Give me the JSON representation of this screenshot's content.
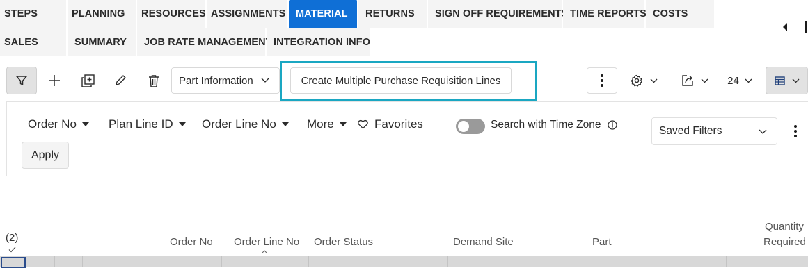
{
  "tabs_row1": [
    {
      "label": "STEPS"
    },
    {
      "label": "PLANNING"
    },
    {
      "label": "RESOURCES"
    },
    {
      "label": "ASSIGNMENTS"
    },
    {
      "label": "MATERIAL",
      "active": true
    },
    {
      "label": "RETURNS"
    },
    {
      "label": "SIGN OFF REQUIREMENTS"
    },
    {
      "label": "TIME REPORTS"
    },
    {
      "label": "COSTS"
    }
  ],
  "tabs_row2": [
    {
      "label": "SALES"
    },
    {
      "label": "SUMMARY"
    },
    {
      "label": "JOB RATE MANAGEMENT"
    },
    {
      "label": "INTEGRATION INFO"
    }
  ],
  "toolbar": {
    "part_info_label": "Part Information",
    "create_pr_label": "Create Multiple Purchase Requisition Lines",
    "page_size": "24"
  },
  "filter_panel": {
    "order_no": "Order No",
    "plan_line_id": "Plan Line ID",
    "order_line_no": "Order Line No",
    "more": "More",
    "favorites": "Favorites",
    "time_zone_label": "Search with Time Zone",
    "saved_filters": "Saved Filters",
    "apply": "Apply"
  },
  "grid": {
    "selected_count": "(2)",
    "columns": {
      "order_no": "Order No",
      "order_line_no": "Order Line No",
      "order_status": "Order Status",
      "demand_site": "Demand Site",
      "part": "Part",
      "quantity_line1": "Quantity",
      "quantity_line2": "Required"
    }
  },
  "colors": {
    "accent": "#0f6fd6",
    "highlight": "#1aa7c2"
  }
}
